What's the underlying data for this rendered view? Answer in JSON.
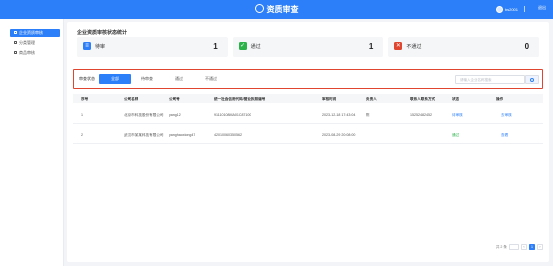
{
  "header": {
    "title": "资质审查",
    "user_name": "bs2001",
    "logout_label": "退出"
  },
  "sidebar": {
    "items": [
      {
        "label": "企业资质审核",
        "active": true
      },
      {
        "label": "分类管理",
        "active": false
      },
      {
        "label": "商品审核",
        "active": false
      }
    ]
  },
  "stats": {
    "title": "企业资质审核状态统计",
    "cards": [
      {
        "label": "待审",
        "value": "1",
        "icon": "list-icon",
        "color": "#2d7ff9"
      },
      {
        "label": "通过",
        "value": "1",
        "icon": "check-icon",
        "color": "#2bb34a"
      },
      {
        "label": "不通过",
        "value": "0",
        "icon": "close-icon",
        "color": "#e0452f"
      }
    ]
  },
  "filter": {
    "label": "审查状态",
    "tabs": [
      {
        "label": "全部",
        "active": true
      },
      {
        "label": "待审查",
        "active": false
      },
      {
        "label": "通过",
        "active": false
      },
      {
        "label": "不通过",
        "active": false
      }
    ],
    "search_placeholder": "请输入企业名称搜索"
  },
  "table": {
    "headers": [
      "序号",
      "公司名称",
      "公司号",
      "统一社会信用代码/营业执照编号",
      "审核时间",
      "负责人",
      "联系人联系方式",
      "状态",
      "操作"
    ],
    "rows": [
      {
        "index": "1",
        "company": "北京市科技股份有限公司",
        "account": "yang12",
        "code": "91110108MA01C87100",
        "time": "2023-12-18 17:43:04",
        "person": "陈",
        "phone": "15252482452",
        "status": "待审核",
        "status_type": "pending",
        "action": "去审核"
      },
      {
        "index": "2",
        "company": "武汉市某某科技有限公司",
        "account": "yanghaoxiong47",
        "code": "42010060350562",
        "time": "2023-08-29 20:08:00",
        "person": "",
        "phone": "",
        "status": "通过",
        "status_type": "ok",
        "action": "查看"
      }
    ]
  },
  "pager": {
    "total_label": "共 2 条",
    "current_page": "1"
  }
}
